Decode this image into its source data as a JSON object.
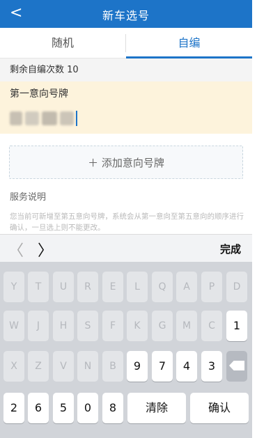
{
  "header": {
    "back_icon": "chevron-left-icon",
    "title": "新车选号"
  },
  "tabs": [
    {
      "label": "随机",
      "active": false
    },
    {
      "label": "自编",
      "active": true
    }
  ],
  "remaining": {
    "text": "剩余自编次数 10"
  },
  "plate": {
    "label": "第一意向号牌",
    "value_blurred": true
  },
  "add_plate": {
    "label": "＋ 添加意向号牌"
  },
  "service": {
    "title": "服务说明",
    "text": "您当前可新增至第五意向号牌，系统会从第一意向至第五意向的顺序进行确认，一旦选上则不能更改。"
  },
  "keyboard_toolbar": {
    "prev_glyph": "〈",
    "next_glyph": "〉",
    "done_label": "完成"
  },
  "keyboard": {
    "row1": [
      "Y",
      "T",
      "U",
      "R",
      "E",
      "L",
      "Q",
      "A",
      "P",
      "D"
    ],
    "row2": [
      "W",
      "J",
      "H",
      "S",
      "F",
      "K",
      "G",
      "M",
      "C",
      "1"
    ],
    "row3": [
      "X",
      "Z",
      "V",
      "N",
      "B",
      "9",
      "7",
      "4",
      "3"
    ],
    "row4": [
      "2",
      "6",
      "5",
      "0",
      "8"
    ],
    "clear_label": "清除",
    "confirm_label": "确认",
    "delete_icon": "backspace-icon"
  },
  "colors": {
    "brand": "#1d74c8",
    "highlight": "#fdf3dc"
  }
}
